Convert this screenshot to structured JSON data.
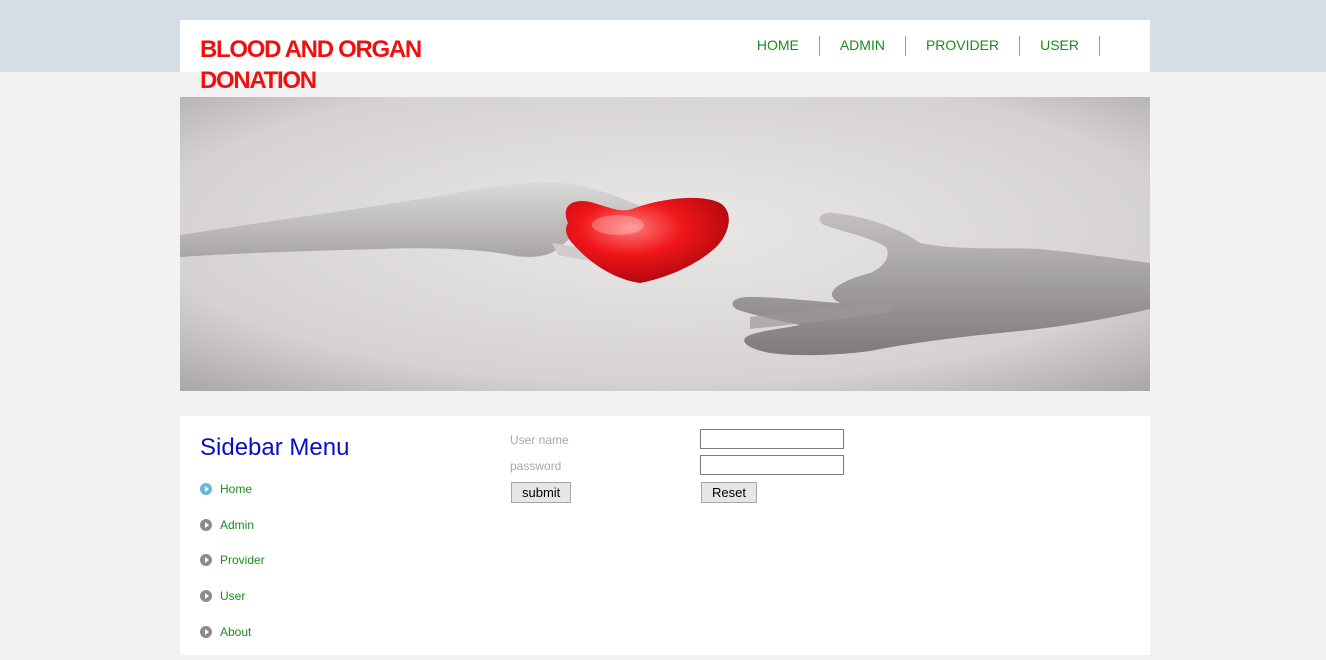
{
  "site": {
    "title": "BLOOD AND ORGAN DONATION"
  },
  "topnav": {
    "items": [
      "HOME",
      "ADMIN",
      "PROVIDER",
      "USER"
    ]
  },
  "sidebar": {
    "title": "Sidebar Menu",
    "items": [
      "Home",
      "Admin",
      "Provider",
      "User",
      "About"
    ]
  },
  "login": {
    "username_label": "User name",
    "password_label": "password",
    "username_value": "",
    "password_value": "",
    "submit_label": "submit",
    "reset_label": "Reset"
  },
  "colors": {
    "title": "#ee1111",
    "nav_link": "#1e8a1e",
    "sidebar_title": "#0b0bcc",
    "active_bullet": "#6cb5dd",
    "heart": "#e8141a"
  },
  "hero": {
    "icon": "heart-hands-photo"
  }
}
